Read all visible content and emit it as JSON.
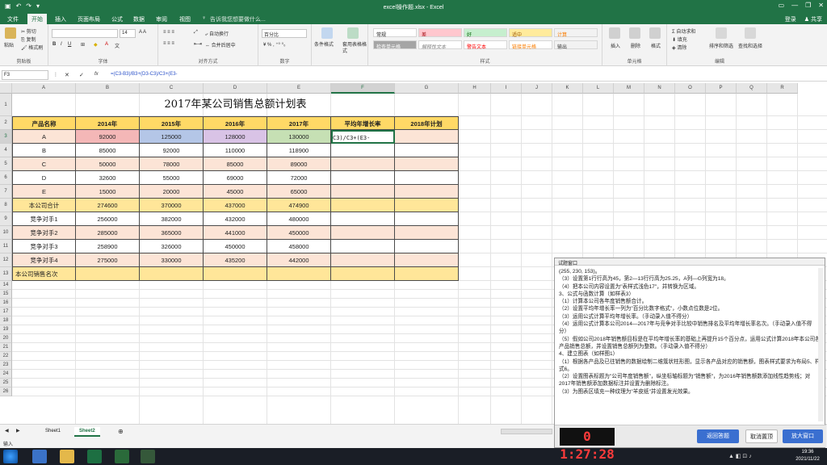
{
  "window": {
    "title": "excel操作题.xlsx - Excel",
    "login": "登录",
    "share": "共享"
  },
  "tabs": [
    "文件",
    "开始",
    "插入",
    "页面布局",
    "公式",
    "数据",
    "审阅",
    "视图"
  ],
  "tell_me": "告诉我您想要做什么...",
  "ribbon": {
    "clipboard": {
      "label": "剪贴板",
      "paste": "粘贴",
      "cut": "剪切",
      "copy": "复制",
      "format_painter": "格式刷"
    },
    "font": {
      "label": "字体",
      "size": "14"
    },
    "alignment": {
      "label": "对齐方式",
      "wrap": "自动换行",
      "merge": "合并后居中"
    },
    "number": {
      "label": "数字",
      "format": "百分比"
    },
    "conditional": "条件格式",
    "format_table": "套用表格格式",
    "styles": {
      "label": "样式",
      "items": [
        "常规",
        "差",
        "好",
        "适中",
        "计算",
        "检查单元格",
        "解释性文本",
        "警告文本",
        "链接单元格",
        "输出"
      ]
    },
    "cells": {
      "label": "单元格",
      "insert": "插入",
      "delete": "删除",
      "format": "格式"
    },
    "editing": {
      "label": "编辑",
      "autosum": "自动求和",
      "fill": "填充",
      "clear": "清除",
      "sort": "排序和筛选",
      "find": "查找和选择"
    }
  },
  "formula_bar": {
    "name_box": "F3",
    "formula": "=(C3-B3)/B3+(D3-C3)/C3+(E3-"
  },
  "columns": [
    "A",
    "B",
    "C",
    "D",
    "E",
    "F",
    "G",
    "H",
    "I",
    "J",
    "K",
    "L",
    "M",
    "N",
    "O",
    "P",
    "Q",
    "R"
  ],
  "rows": [
    "1",
    "2",
    "3",
    "4",
    "5",
    "6",
    "7",
    "8",
    "9",
    "10",
    "11",
    "12",
    "13",
    "14",
    "15",
    "16",
    "17",
    "18",
    "19",
    "20",
    "21",
    "22",
    "23",
    "24",
    "25",
    "26"
  ],
  "table": {
    "title": "2017年某公司销售总额计划表",
    "headers": [
      "产品名称",
      "2014年",
      "2015年",
      "2016年",
      "2017年",
      "平均年增长率",
      "2018年计划"
    ],
    "data": [
      [
        "A",
        "92000",
        "125000",
        "128000",
        "130000",
        "C3)/C3+(E3-",
        ""
      ],
      [
        "B",
        "85000",
        "92000",
        "110000",
        "118900",
        "",
        ""
      ],
      [
        "C",
        "50000",
        "78000",
        "85000",
        "89000",
        "",
        ""
      ],
      [
        "D",
        "32600",
        "55000",
        "69000",
        "72000",
        "",
        ""
      ],
      [
        "E",
        "15000",
        "20000",
        "45000",
        "65000",
        "",
        ""
      ],
      [
        "本公司合计",
        "274600",
        "370000",
        "437000",
        "474900",
        "",
        ""
      ],
      [
        "竞争对手1",
        "256000",
        "382000",
        "432000",
        "480000",
        "",
        ""
      ],
      [
        "竞争对手2",
        "285000",
        "365000",
        "441000",
        "450000",
        "",
        ""
      ],
      [
        "竞争对手3",
        "258900",
        "326000",
        "450000",
        "458000",
        "",
        ""
      ],
      [
        "竞争对手4",
        "275000",
        "330000",
        "435200",
        "442000",
        "",
        ""
      ],
      [
        "本公司销售名次",
        "",
        "",
        "",
        "",
        "",
        ""
      ]
    ]
  },
  "sheets": [
    "Sheet1",
    "Sheet2"
  ],
  "status": "输入",
  "panel": {
    "title": "试题窗口",
    "text": "(255, 230, 153)。\n（3）设置第1行行高为45，第2—13行行高为25.25，A列—G列宽为18。\n（4）把本公司内容设置为\"表样式浅色17\"，并转换为区域。\n3、公式与函数计算（如样表3）\n（1）计算本公司各年度销售额合计。\n（2）设置平均年增长率一列为\"百分比数字格式\"，小数点位数是2位。\n（3）运用公式计算平均年增长率。（手动录入值不得分）\n（4）运用公式计算本公司2014—2017年与竞争对手比较中销售排名及平均年增长率名次。（手动录入值不得分）\n（5）假如公司2018年销售额目标是在平均年增长率的基础上再提升15个百分点，运用公式计算2018年本公司各产品销售总额，并设置销售总额列为整数。（手动录入值不得分）\n4、建立图表（如样图1）\n（1）根据各产品及已往销售的数据绘制二维簇状柱形图，显示各产品对应的销售额，图表样式要求为布局5、样式6。\n（2）设置图表标题为\"公司年度销售额\"，纵坐标轴标题为\"销售额\"，为2016年销售额数添加线性趋势线；对2017年销售额添加数据标注并设置为删除标注。\n（3）为图表区填充一种纹理为\"羊皮纸\"并设置发光效果。",
    "timer": "0 1:27:28",
    "btn_back": "返回答题",
    "btn_cancel": "取消置顶",
    "btn_zoom": "放大窗口"
  },
  "clock": {
    "time": "19:36",
    "date": "2021/11/22"
  }
}
